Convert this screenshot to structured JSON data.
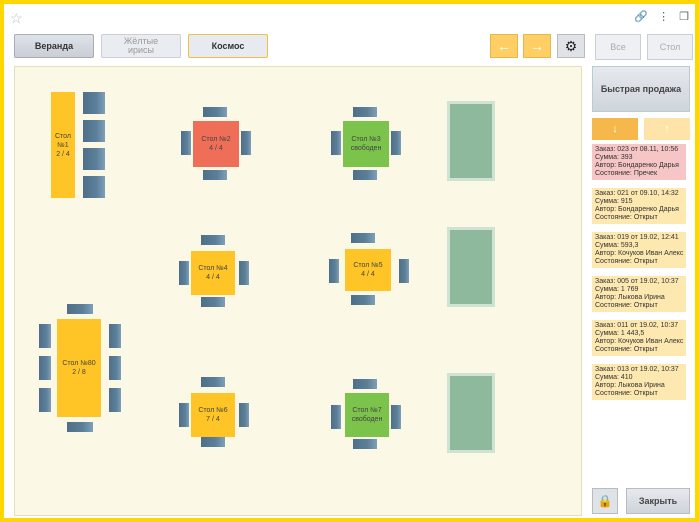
{
  "tabs": [
    {
      "label": "Веранда"
    },
    {
      "label": "Жёлтые ирисы"
    },
    {
      "label": "Космос"
    }
  ],
  "nav_buttons": [
    "←",
    "→"
  ],
  "right_buttons": {
    "all": "Все",
    "table": "Стол"
  },
  "tables": [
    {
      "name": "Стол №1",
      "info": "2 / 4",
      "status": "busy"
    },
    {
      "name": "Стол №2",
      "info": "4 / 4",
      "status": "overdue"
    },
    {
      "name": "Стол №3",
      "info": "свободен",
      "status": "free"
    },
    {
      "name": "Стол №4",
      "info": "4 / 4",
      "status": "busy"
    },
    {
      "name": "Стол №5",
      "info": "4 / 4",
      "status": "busy"
    },
    {
      "name": "Стол №6",
      "info": "7 / 4",
      "status": "busy"
    },
    {
      "name": "Стол №7",
      "info": "свободен",
      "status": "free"
    },
    {
      "name": "Стол №80",
      "info": "2 / 8",
      "status": "busy"
    }
  ],
  "sidebar": {
    "fast_sale": "Быстрая продажа",
    "orders": [
      {
        "line1": "Заказ: 023 от 08.11, 10:56",
        "line2": "Сумма: 393",
        "line3": "Автор: Бондаренко Дарья",
        "line4": "Состояние: Пречек",
        "status": "precheck"
      },
      {
        "line1": "Заказ: 021 от 09.10, 14:32",
        "line2": "Сумма: 915",
        "line3": "Автор: Бондаренко Дарья",
        "line4": "Состояние: Открыт",
        "status": "open"
      },
      {
        "line1": "Заказ: 019 от 19.02, 12:41",
        "line2": "Сумма: 593,3",
        "line3": "Автор: Кочуков Иван Алекс",
        "line4": "Состояние: Открыт",
        "status": "open"
      },
      {
        "line1": "Заказ: 005 от 19.02, 10:37",
        "line2": "Сумма: 1 769",
        "line3": "Автор: Лыкова Ирина",
        "line4": "Состояние: Открыт",
        "status": "open"
      },
      {
        "line1": "Заказ: 011 от 19.02, 10:37",
        "line2": "Сумма: 1 443,5",
        "line3": "Автор: Кочуков Иван Алекс",
        "line4": "Состояние: Открыт",
        "status": "open"
      },
      {
        "line1": "Заказ: 013 от 19.02, 10:37",
        "line2": "Сумма: 410",
        "line3": "Автор: Лыкова Ирина",
        "line4": "Состояние: Открыт",
        "status": "open"
      }
    ],
    "close": "Закрыть"
  },
  "colors": {
    "busy": "#ffc526",
    "free": "#7bc34a",
    "overdue": "#ee6e58",
    "chair": "#5c7f99",
    "sofa": "#8fb99d"
  }
}
